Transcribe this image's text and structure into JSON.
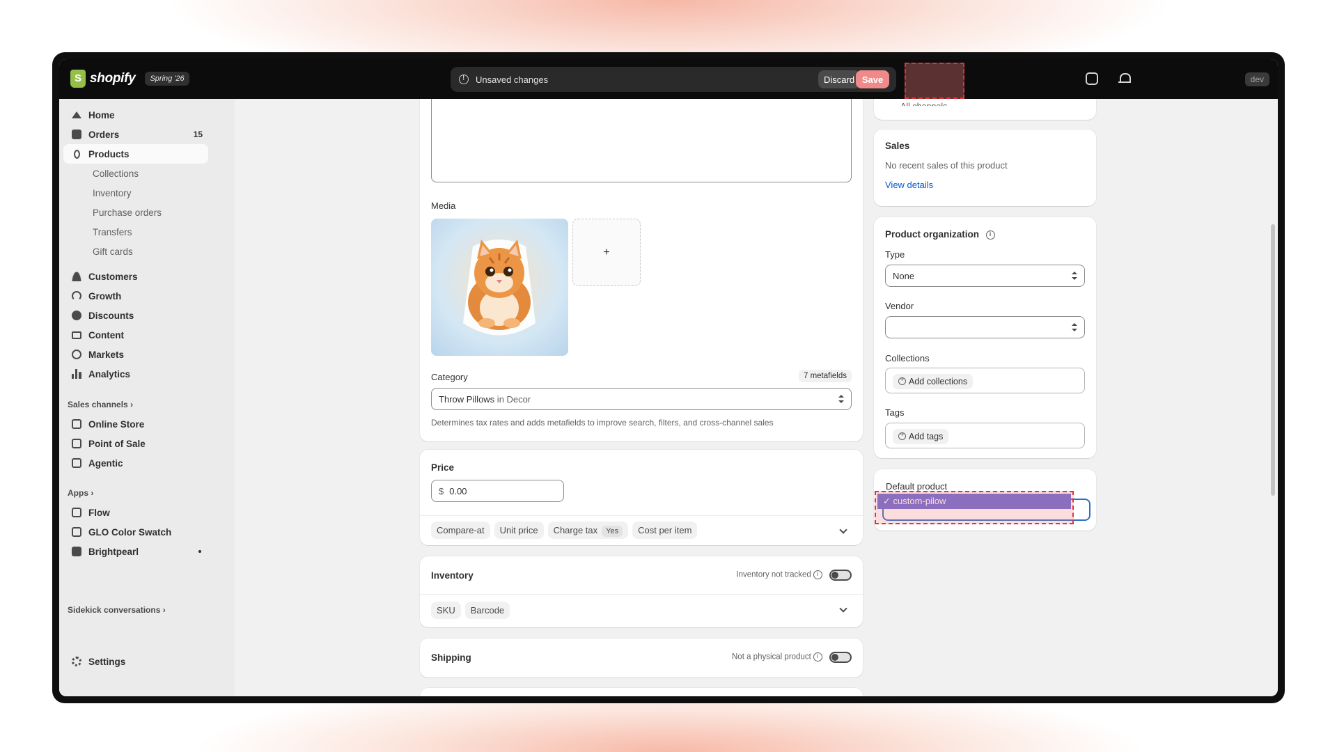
{
  "topbar": {
    "brand": "shopify",
    "edition": "Spring '26",
    "unsaved_label": "Unsaved changes",
    "discard_label": "Discard",
    "save_label": "Save",
    "env_badge": "dev"
  },
  "sidebar": {
    "items": [
      {
        "label": "Home",
        "icon": "home-icon"
      },
      {
        "label": "Orders",
        "icon": "inbox-icon",
        "count": "15"
      },
      {
        "label": "Products",
        "icon": "tag-icon"
      },
      {
        "label": "Customers",
        "icon": "person-icon"
      },
      {
        "label": "Growth",
        "icon": "gauge-icon"
      },
      {
        "label": "Discounts",
        "icon": "discount-icon"
      },
      {
        "label": "Content",
        "icon": "monitor-icon"
      },
      {
        "label": "Markets",
        "icon": "globe-icon"
      },
      {
        "label": "Analytics",
        "icon": "bar-chart-icon"
      }
    ],
    "product_subitems": [
      "Collections",
      "Inventory",
      "Purchase orders",
      "Transfers",
      "Gift cards"
    ],
    "sales_channels_heading": "Sales channels",
    "sales_channels": [
      "Online Store",
      "Point of Sale",
      "Agentic"
    ],
    "apps_heading": "Apps",
    "apps": [
      "Flow",
      "GLO Color Swatch",
      "Brightpearl"
    ],
    "sidekick_heading": "Sidekick conversations",
    "settings_label": "Settings"
  },
  "main": {
    "media_label": "Media",
    "add_media_symbol": "+",
    "category": {
      "label": "Category",
      "metafields_badge": "7 metafields",
      "value_main": "Throw Pillows",
      "value_suffix": " in Decor",
      "help": "Determines tax rates and adds metafields to improve search, filters, and cross-channel sales"
    },
    "price": {
      "title": "Price",
      "currency": "$",
      "value": "0.00",
      "pills": [
        "Compare-at",
        "Unit price",
        "Charge tax",
        "Cost per item"
      ],
      "charge_tax_value": "Yes"
    },
    "inventory": {
      "title": "Inventory",
      "status": "Inventory not tracked",
      "pills": [
        "SKU",
        "Barcode"
      ]
    },
    "shipping": {
      "title": "Shipping",
      "status": "Not a physical product"
    }
  },
  "right": {
    "channels_partial": "All channels",
    "sales": {
      "title": "Sales",
      "text": "No recent sales of this product",
      "link": "View details"
    },
    "org": {
      "title": "Product organization",
      "type_label": "Type",
      "type_value": "None",
      "vendor_label": "Vendor",
      "vendor_value": "",
      "collections_label": "Collections",
      "collections_add": "Add collections",
      "tags_label": "Tags",
      "tags_add": "Add tags"
    },
    "template_dropdown": {
      "options": [
        "Default product",
        "custom-pilow"
      ],
      "selected": "custom-pilow",
      "check": "✓"
    }
  },
  "colors": {
    "accent_save": "#f08a8a",
    "selected_option": "#6b6bd6",
    "link": "#005bd3"
  }
}
